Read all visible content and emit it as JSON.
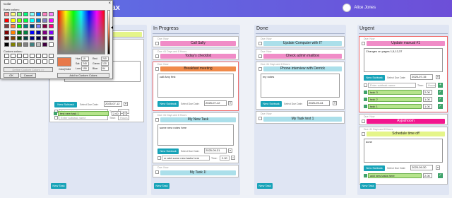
{
  "app": {
    "title": "tax",
    "user": "Alice Jones"
  },
  "lanes": [
    {
      "name": "In Progress",
      "new_task": "New Task"
    },
    {
      "name": "Done",
      "new_task": "New Task"
    },
    {
      "name": "Urgent",
      "new_task": "New Task"
    }
  ],
  "first_lane": {
    "new_task": "New Task"
  },
  "cards": {
    "c1": {
      "due": "Due: Now",
      "title": "Call Sally"
    },
    "c2": {
      "due": "Due: 61 Days and 8 Hours",
      "title": "Today's checklist"
    },
    "c3": {
      "due": "Due: Now",
      "title": "Breakfast meeting",
      "note": "call Amy first",
      "btn": "New Subtask",
      "lbl": "Select Due Date:",
      "date": "2025-07-12"
    },
    "c4": {
      "due": "Due: 61 Days and 8 Hours",
      "title": "My New Task",
      "note": "some new notes here",
      "btn": "New Subtask",
      "lbl": "Select Due Date:",
      "date": "2025-09-31",
      "sub": "or add some new tasks here",
      "time": "Time:",
      "time_val": "2.00"
    },
    "c5": {
      "due": "Due: Now",
      "title": "My Task 1!"
    },
    "d1": {
      "due": "Due: Now",
      "title": "Update Computer with IT"
    },
    "d2": {
      "due": "Due: Now",
      "title": "Check admin mailbox"
    },
    "d3": {
      "due": "Due: 61 Days and 8 Hours",
      "title": "Phone interview with Derrick",
      "note": "my notes",
      "btn": "New Subtask",
      "lbl": "Select Due Date:",
      "date": "2025-09-44"
    },
    "d4": {
      "due": "Due: Now",
      "title": "My Task test 1"
    },
    "u1": {
      "due": "Due: Now",
      "title": "Update manual #1",
      "note": "Changes on pages 1,5,12,37",
      "btn": "New Subtask",
      "lbl": "Select Due Date:",
      "date": "2025-07-15",
      "sub_ph": "Enter subtask name",
      "time": "Time:",
      "time_ph": "Hours",
      "subs": [
        "task 3",
        "task 2",
        "task 1"
      ],
      "sub_vals": [
        "2.00",
        "1.00",
        "1.00"
      ]
    },
    "u2": {
      "due": "Due: Now",
      "title": "Ayjoshoom"
    },
    "u3": {
      "due": "Due: 61 Days and 8 Hours",
      "title": "Schedule time off",
      "note": "done",
      "btn": "New Subtask",
      "lbl": "Select Due Date:",
      "date": "2025-09-30",
      "sub": "add new tasks here",
      "sub_val": "2.00"
    }
  },
  "leftcard": {
    "btn": "New Subtask",
    "lbl": "Select Due Date:",
    "date": "2025-07-12",
    "sub_ph": "Enter subtask name",
    "time": "Time:",
    "time_ph": "Hours",
    "sub_ph2": "Enter subtask name",
    "sub": "test new task 1",
    "sub_val": "2.00"
  },
  "color_dialog": {
    "title": "Color",
    "basic": "Basic colors:",
    "custom": "Custom colors:",
    "define": "Define Custom Colors >>",
    "ok": "OK",
    "cancel": "Cancel",
    "color_solid": "Color|Solid",
    "add": "Add to Custom Colors",
    "hue_lbl": "Hue:",
    "hue": "19",
    "sat_lbl": "Sat:",
    "sat": "240",
    "lum_lbl": "Lum:",
    "lum": "150",
    "red_lbl": "Red:",
    "red": "240",
    "green_lbl": "Green:",
    "green": "120",
    "blue_lbl": "Blue:",
    "blue": "84",
    "swatches": [
      "#ff8080",
      "#ffff80",
      "#80ff80",
      "#00ff80",
      "#80ffff",
      "#0080ff",
      "#ff80c0",
      "#ff80ff",
      "#ff0000",
      "#ffff00",
      "#80ff00",
      "#00ff40",
      "#00ffff",
      "#0080c0",
      "#8080c0",
      "#ff00ff",
      "#804040",
      "#ff8040",
      "#00ff00",
      "#008080",
      "#004080",
      "#8080ff",
      "#800040",
      "#ff0080",
      "#800000",
      "#ff8000",
      "#008000",
      "#008040",
      "#0000ff",
      "#0000a0",
      "#800080",
      "#8000ff",
      "#400000",
      "#804000",
      "#004000",
      "#004040",
      "#000080",
      "#000040",
      "#400040",
      "#400080",
      "#000000",
      "#808000",
      "#808040",
      "#808080",
      "#408080",
      "#c0c0c0",
      "#400040",
      "#ffffff"
    ]
  }
}
